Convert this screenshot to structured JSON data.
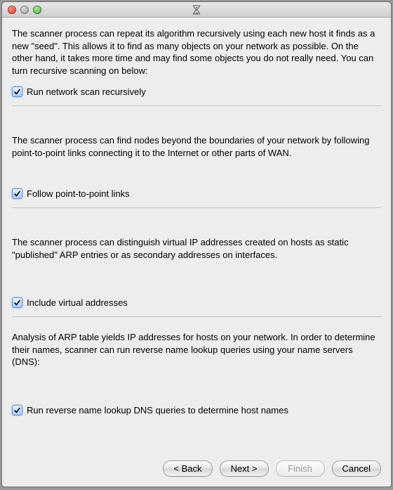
{
  "titlebar": {
    "icon_name": "hourglass-icon"
  },
  "sections": {
    "recursive": {
      "paragraph": "The scanner process can repeat its algorithm recursively using each new host it finds as a new \"seed\". This allows it to find as many objects on your network as possible. On the other hand, it takes more time and may find some objects you do not really need. You can turn recursive scanning on below:",
      "checkbox_label": "Run network scan recursively",
      "checked": true
    },
    "ptp": {
      "paragraph": "The scanner process can find nodes beyond the boundaries of your network by following point-to-point links connecting it to the Internet or other parts of WAN.",
      "checkbox_label": "Follow point-to-point links",
      "checked": true
    },
    "virtual": {
      "paragraph": "The scanner process can distinguish virtual IP addresses created on hosts as static \"published\" ARP entries or as secondary addresses on interfaces.",
      "checkbox_label": "Include virtual addresses",
      "checked": true
    },
    "dns": {
      "paragraph": "Analysis of ARP table yields IP addresses for hosts on your network. In order to determine their names, scanner can run reverse name lookup queries using your name servers (DNS):",
      "checkbox_label": "Run reverse name lookup DNS queries to determine host names",
      "checked": true
    }
  },
  "buttons": {
    "back": "< Back",
    "next": "Next >",
    "finish": "Finish",
    "cancel": "Cancel"
  }
}
